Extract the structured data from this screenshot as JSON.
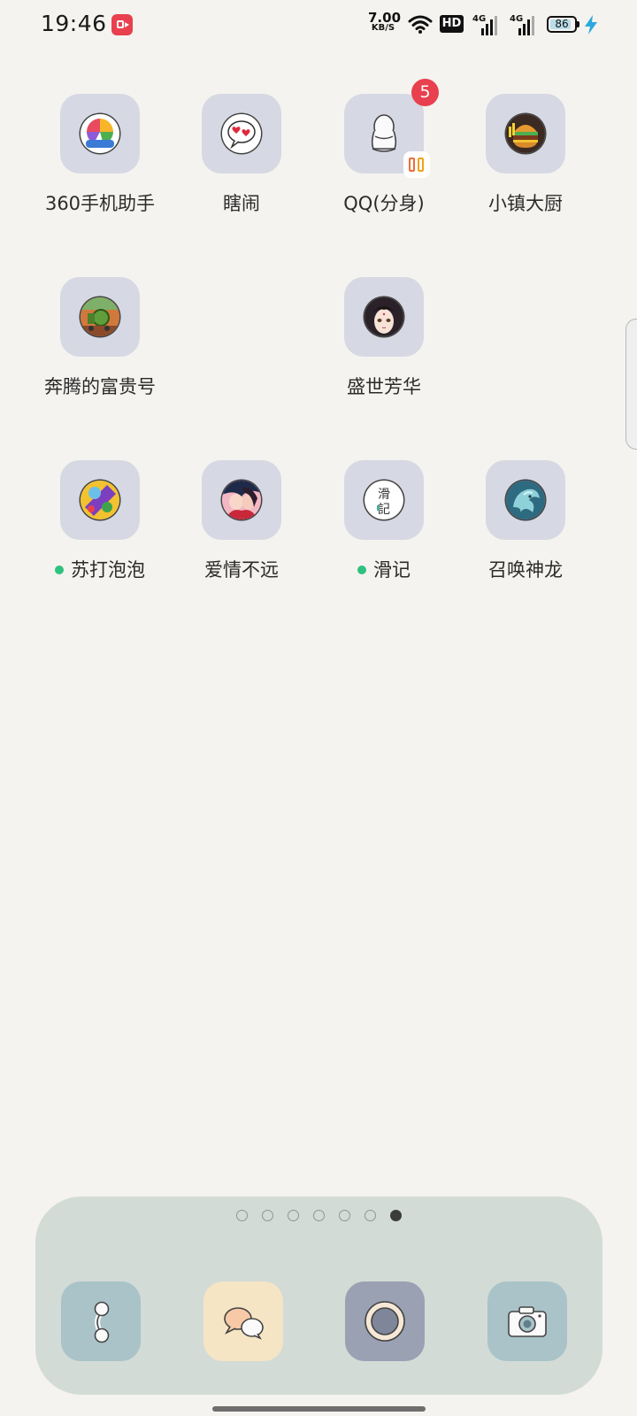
{
  "status_bar": {
    "time": "19:46",
    "net_speed_value": "7.00",
    "net_speed_unit": "KB/S",
    "hd_label": "HD",
    "sim1_label": "4G",
    "sim2_label": "4G",
    "battery_level": "86",
    "charging": true
  },
  "apps": [
    {
      "label": "360手机助手",
      "icon": "360-assistant-icon"
    },
    {
      "label": "瞎闹",
      "icon": "hearts-speech-bubble-icon"
    },
    {
      "label": "QQ(分身)",
      "icon": "qq-penguin-icon",
      "badge": "5",
      "dual_app": true
    },
    {
      "label": "小镇大厨",
      "icon": "burger-icon"
    },
    {
      "label": "奔腾的富贵号",
      "icon": "train-icon"
    },
    {
      "label": "盛世芳华",
      "icon": "anime-girl-icon"
    },
    {
      "label": "苏打泡泡",
      "icon": "soda-bubble-icon",
      "new_dot": true
    },
    {
      "label": "爱情不远",
      "icon": "couple-icon"
    },
    {
      "label": "滑记",
      "icon": "huaji-logo-icon",
      "icon_text": "滑\n記",
      "new_dot": true
    },
    {
      "label": "召唤神龙",
      "icon": "dragon-icon"
    }
  ],
  "pager": {
    "pages": 7,
    "current": 7
  },
  "dock": [
    {
      "icon": "phone-icon",
      "color": "#a9c3c8"
    },
    {
      "icon": "messages-icon",
      "color": "#f5e5c4"
    },
    {
      "icon": "browser-icon",
      "color": "#9aa1b3"
    },
    {
      "icon": "camera-icon",
      "color": "#a9c3c8"
    }
  ]
}
